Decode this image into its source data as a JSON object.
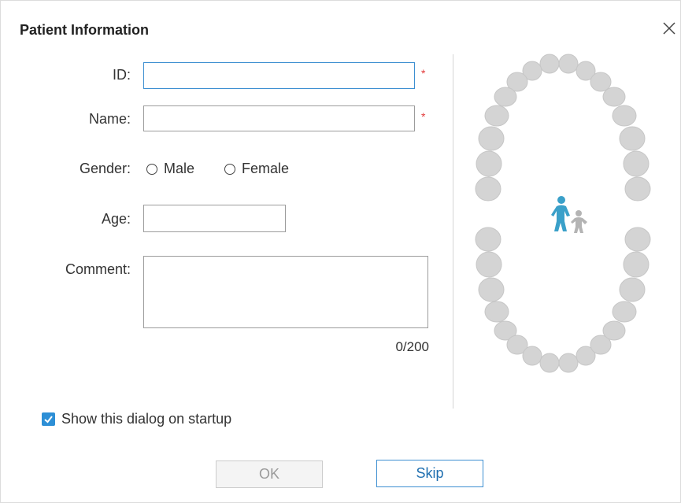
{
  "dialog": {
    "title": "Patient Information"
  },
  "form": {
    "id_label": "ID:",
    "id_value": "",
    "name_label": "Name:",
    "name_value": "",
    "required_mark": "*",
    "gender_label": "Gender:",
    "gender_options": [
      "Male",
      "Female"
    ],
    "age_label": "Age:",
    "age_value": "",
    "comment_label": "Comment:",
    "comment_value": "",
    "comment_counter": "0/200"
  },
  "startup_checkbox": {
    "label": "Show this dialog on startup",
    "checked": true
  },
  "buttons": {
    "ok_label": "OK",
    "skip_label": "Skip"
  },
  "colors": {
    "accent": "#2d8fd6",
    "required": "#e23a3a",
    "tooth": "#d4d4d4",
    "adult_figure": "#3aa0c9",
    "child_figure": "#b4b4b4"
  },
  "icons": {
    "close": "close-icon",
    "checkbox": "check-icon",
    "dental_chart": "dental-arch-icon",
    "patient_type": "adult-child-icon"
  }
}
